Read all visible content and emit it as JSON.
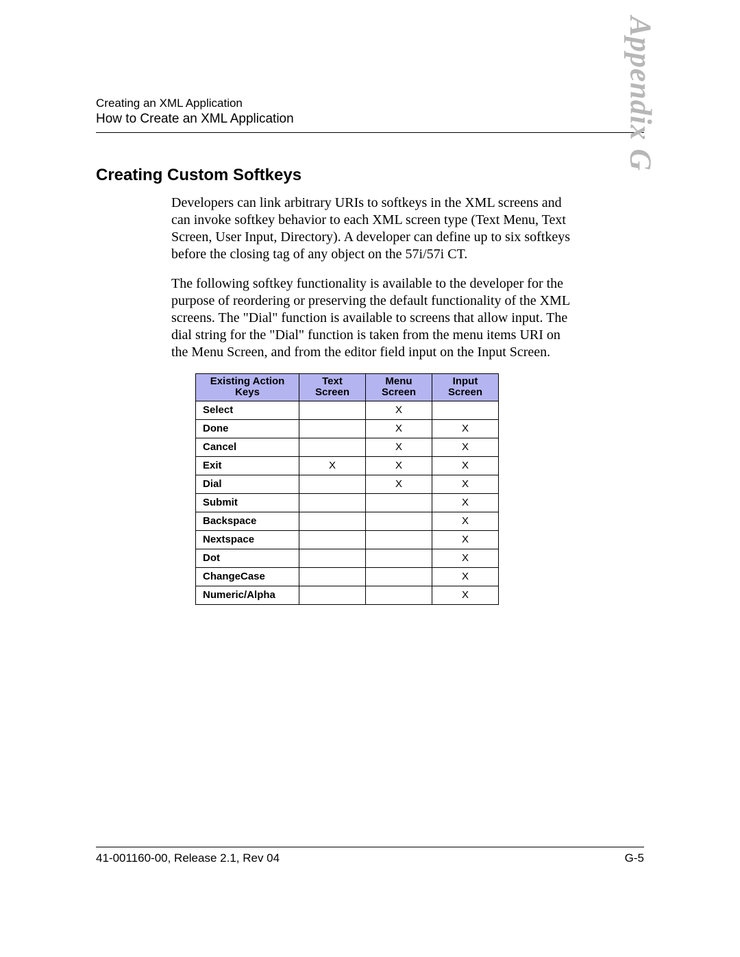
{
  "header": {
    "line1": "Creating an XML Application",
    "line2": "How to Create an XML Application"
  },
  "watermark": "Appendix G",
  "section": {
    "title": "Creating Custom Softkeys",
    "para1": "Developers can link arbitrary URIs to softkeys in the XML screens and can invoke softkey behavior to each XML screen type (Text Menu, Text Screen, User Input, Directory). A developer can define up to six softkeys before the closing tag of any object on the 57i/57i CT.",
    "para2": "The following softkey functionality is available to the developer for the purpose of reordering or preserving the default functionality of the XML screens.  The \"Dial\" function is available to screens that allow input.  The dial string for the \"Dial\" function is taken from the menu items URI on the Menu Screen, and from the editor field input on the Input Screen."
  },
  "table": {
    "headers": [
      "Existing Action Keys",
      "Text Screen",
      "Menu Screen",
      "Input Screen"
    ],
    "rows": [
      {
        "label": "Select",
        "cells": [
          "",
          "X",
          ""
        ]
      },
      {
        "label": "Done",
        "cells": [
          "",
          "X",
          "X"
        ]
      },
      {
        "label": "Cancel",
        "cells": [
          "",
          "X",
          "X"
        ]
      },
      {
        "label": "Exit",
        "cells": [
          "X",
          "X",
          "X"
        ]
      },
      {
        "label": "Dial",
        "cells": [
          "",
          "X",
          "X"
        ]
      },
      {
        "label": "Submit",
        "cells": [
          "",
          "",
          "X"
        ]
      },
      {
        "label": "Backspace",
        "cells": [
          "",
          "",
          "X"
        ]
      },
      {
        "label": "Nextspace",
        "cells": [
          "",
          "",
          "X"
        ]
      },
      {
        "label": "Dot",
        "cells": [
          "",
          "",
          "X"
        ]
      },
      {
        "label": "ChangeCase",
        "cells": [
          "",
          "",
          "X"
        ]
      },
      {
        "label": "Numeric/Alpha",
        "cells": [
          "",
          "",
          "X"
        ]
      }
    ]
  },
  "footer": {
    "left": "41-001160-00, Release 2.1, Rev 04",
    "right": "G-5"
  }
}
